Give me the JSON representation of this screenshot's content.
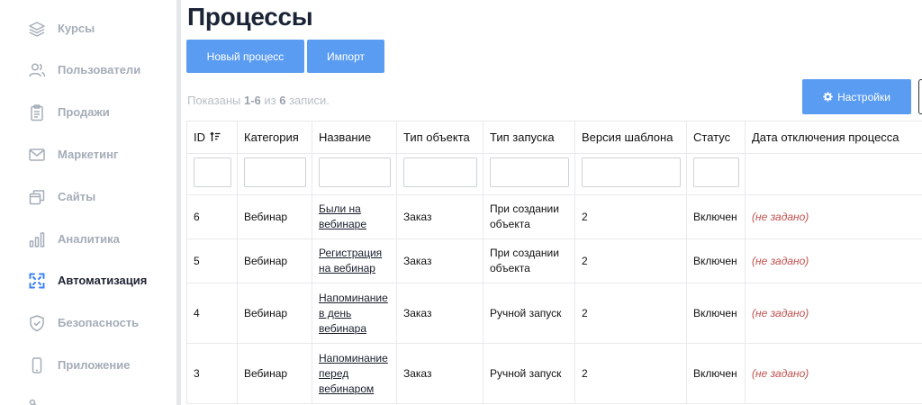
{
  "sidebar": {
    "items": [
      {
        "label": "Курсы",
        "icon": "layers-icon",
        "active": false
      },
      {
        "label": "Пользователи",
        "icon": "users-icon",
        "active": false
      },
      {
        "label": "Продажи",
        "icon": "clipboard-icon",
        "active": false
      },
      {
        "label": "Маркетинг",
        "icon": "mail-icon",
        "active": false
      },
      {
        "label": "Сайты",
        "icon": "windows-icon",
        "active": false
      },
      {
        "label": "Аналитика",
        "icon": "bar-chart-icon",
        "active": false
      },
      {
        "label": "Автоматизация",
        "icon": "automation-icon",
        "active": true
      },
      {
        "label": "Безопасность",
        "icon": "shield-check-icon",
        "active": false
      },
      {
        "label": "Приложение",
        "icon": "phone-icon",
        "active": false
      }
    ]
  },
  "colors": {
    "accent": "#5a9cf2",
    "active_icon": "#3b82f6",
    "muted": "#a5adb8",
    "not_set": "#c0504d"
  },
  "page": {
    "title": "Процессы",
    "new_button": "Новый процесс",
    "import_button": "Импорт",
    "settings_button": "Настройки",
    "summary_prefix": "Показаны ",
    "summary_range": "1-6",
    "summary_mid": " из ",
    "summary_total": "6",
    "summary_suffix": " записи."
  },
  "table": {
    "columns": [
      "ID",
      "Категория",
      "Название",
      "Тип объекта",
      "Тип запуска",
      "Версия шаблона",
      "Статус",
      "Дата отключения процесса"
    ],
    "rows": [
      {
        "id": "6",
        "category": "Вебинар",
        "name": [
          "Были на",
          "вебинаре"
        ],
        "object_type": "Заказ",
        "launch_type": [
          "При создании",
          "объекта"
        ],
        "version": "2",
        "status": "Включен",
        "disable_date": "(не задано)"
      },
      {
        "id": "5",
        "category": "Вебинар",
        "name": [
          "Регистрация",
          "на вебинар"
        ],
        "object_type": "Заказ",
        "launch_type": [
          "При создании",
          "объекта"
        ],
        "version": "2",
        "status": "Включен",
        "disable_date": "(не задано)"
      },
      {
        "id": "4",
        "category": "Вебинар",
        "name": [
          "Напоминание",
          "в день",
          "вебинара"
        ],
        "object_type": "Заказ",
        "launch_type": [
          "Ручной запуск"
        ],
        "version": "2",
        "status": "Включен",
        "disable_date": "(не задано)"
      },
      {
        "id": "3",
        "category": "Вебинар",
        "name": [
          "Напоминание",
          "перед",
          "вебинаром"
        ],
        "object_type": "Заказ",
        "launch_type": [
          "Ручной запуск"
        ],
        "version": "2",
        "status": "Включен",
        "disable_date": "(не задано)"
      }
    ]
  }
}
